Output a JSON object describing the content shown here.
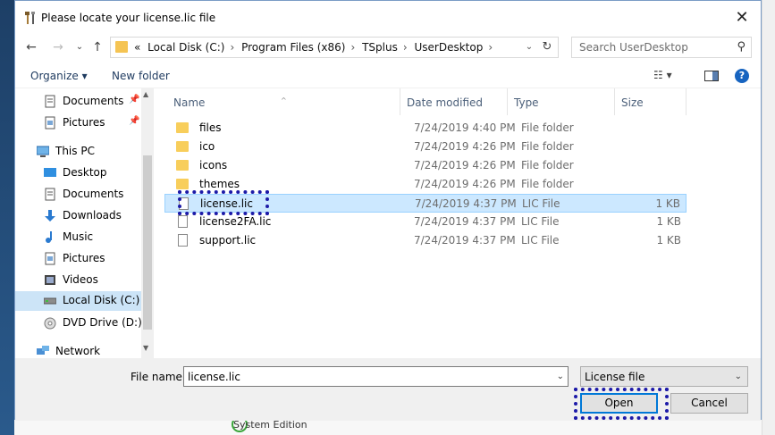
{
  "window": {
    "title": "Please locate your license.lic file",
    "close_glyph": "✕"
  },
  "nav": {
    "back_glyph": "←",
    "forward_glyph": "→",
    "recent_glyph": "⌄",
    "up_glyph": "↑",
    "overflow": "«",
    "breadcrumbs": [
      "Local Disk (C:)",
      "Program Files (x86)",
      "TSplus",
      "UserDesktop"
    ],
    "separator": "›",
    "dropdown_glyph": "⌄",
    "refresh_glyph": "↻"
  },
  "search": {
    "placeholder": "Search UserDesktop",
    "icon_glyph": "⚲"
  },
  "toolbar": {
    "organize": "Organize ▾",
    "new_folder": "New folder",
    "views_glyph": "☷ ▾",
    "help_glyph": "?"
  },
  "sidebar": {
    "items": [
      {
        "label": "Documents",
        "icon": "documents-icon",
        "pinned": true
      },
      {
        "label": "Pictures",
        "icon": "pictures-icon",
        "pinned": true
      },
      {
        "label": "This PC",
        "icon": "computer-icon",
        "pinned": false
      },
      {
        "label": "Desktop",
        "icon": "desktop-icon",
        "pinned": false
      },
      {
        "label": "Documents",
        "icon": "documents-icon",
        "pinned": false
      },
      {
        "label": "Downloads",
        "icon": "downloads-icon",
        "pinned": false
      },
      {
        "label": "Music",
        "icon": "music-icon",
        "pinned": false
      },
      {
        "label": "Pictures",
        "icon": "pictures-icon",
        "pinned": false
      },
      {
        "label": "Videos",
        "icon": "videos-icon",
        "pinned": false
      },
      {
        "label": "Local Disk (C:)",
        "icon": "drive-icon",
        "pinned": false,
        "selected": true
      },
      {
        "label": "DVD Drive (D:) IS",
        "icon": "dvd-icon",
        "pinned": false
      },
      {
        "label": "Network",
        "icon": "network-icon",
        "pinned": false
      }
    ],
    "pin_glyph": "📌",
    "scroll_up_glyph": "▲",
    "scroll_down_glyph": "▼"
  },
  "columns": {
    "name": "Name",
    "date": "Date modified",
    "type": "Type",
    "size": "Size",
    "sort_glyph": "^"
  },
  "files": [
    {
      "name": "files",
      "date": "7/24/2019 4:40 PM",
      "type": "File folder",
      "size": "",
      "kind": "folder"
    },
    {
      "name": "ico",
      "date": "7/24/2019 4:26 PM",
      "type": "File folder",
      "size": "",
      "kind": "folder"
    },
    {
      "name": "icons",
      "date": "7/24/2019 4:26 PM",
      "type": "File folder",
      "size": "",
      "kind": "folder"
    },
    {
      "name": "themes",
      "date": "7/24/2019 4:26 PM",
      "type": "File folder",
      "size": "",
      "kind": "folder"
    },
    {
      "name": "license.lic",
      "date": "7/24/2019 4:37 PM",
      "type": "LIC File",
      "size": "1 KB",
      "kind": "file",
      "selected": true
    },
    {
      "name": "license2FA.lic",
      "date": "7/24/2019 4:37 PM",
      "type": "LIC File",
      "size": "1 KB",
      "kind": "file"
    },
    {
      "name": "support.lic",
      "date": "7/24/2019 4:37 PM",
      "type": "LIC File",
      "size": "1 KB",
      "kind": "file"
    }
  ],
  "bottom": {
    "file_name_label": "File name:",
    "file_name_value": "license.lic",
    "file_type_value": "License file",
    "dropdown_glyph": "⌄",
    "open": "Open",
    "cancel": "Cancel"
  },
  "background": {
    "text": "System Edition"
  },
  "colors": {
    "accent": "#0078d7",
    "selection": "#cce8ff",
    "highlight_dots": "#1d1aa8",
    "folder": "#f8ce5b"
  }
}
